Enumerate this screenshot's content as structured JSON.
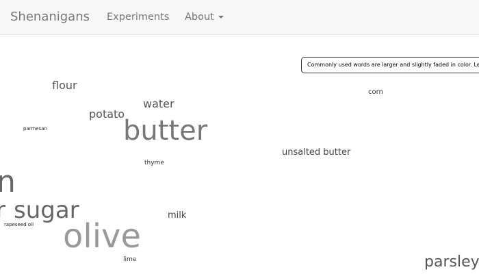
{
  "navbar": {
    "brand": "Shenanigans",
    "experiments": "Experiments",
    "about": "About"
  },
  "tooltip": {
    "text": "Commonly used words are larger and slightly faded in color. Less"
  },
  "cloud": {
    "words": [
      {
        "text": "flour",
        "color": "#555555"
      },
      {
        "text": "water",
        "color": "#555555"
      },
      {
        "text": "potato",
        "color": "#555555"
      },
      {
        "text": "butter",
        "color": "#777777"
      },
      {
        "text": "parmesan",
        "color": "#222222"
      },
      {
        "text": "corn",
        "color": "#333333"
      },
      {
        "text": "unsalted butter",
        "color": "#444444"
      },
      {
        "text": "thyme",
        "color": "#333333"
      },
      {
        "text": "n",
        "color": "#666666"
      },
      {
        "text": "r",
        "color": "#666666"
      },
      {
        "text": "sugar",
        "color": "#666666"
      },
      {
        "text": "milk",
        "color": "#444444"
      },
      {
        "text": "rapeseed oil",
        "color": "#222222"
      },
      {
        "text": "olive",
        "color": "#999999"
      },
      {
        "text": "lime",
        "color": "#333333"
      },
      {
        "text": "parsley",
        "color": "#555555"
      }
    ]
  }
}
